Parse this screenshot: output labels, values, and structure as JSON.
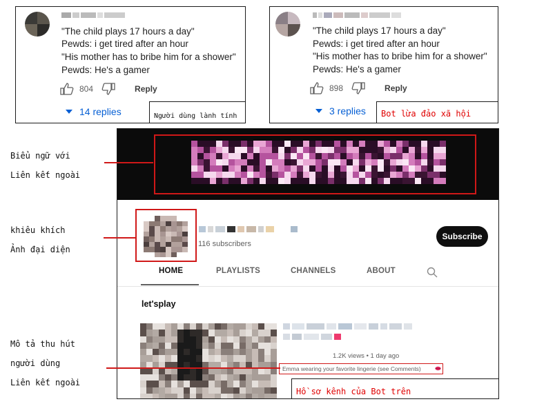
{
  "comment1": {
    "lines": [
      "\"The child plays 17 hours a day\"",
      "Pewds: i get tired after an hour",
      "\"His mother has to bribe him for a shower\"",
      "Pewds: He's a gamer"
    ],
    "likes": "804",
    "reply": "Reply",
    "replies": "14 replies",
    "tag": "Người dùng lành tính"
  },
  "comment2": {
    "lines": [
      "\"The child plays 17 hours a day\"",
      "Pewds: i get tired after an hour",
      "\"His mother has to bribe him for a shower\"",
      "Pewds: He's a gamer"
    ],
    "likes": "898",
    "reply": "Reply",
    "replies": "3 replies",
    "tag": "Bot lừa đảo xã hội"
  },
  "channel": {
    "subscribers": "116 subscribers",
    "subscribe": "Subscribe",
    "tabs": [
      "HOME",
      "PLAYLISTS",
      "CHANNELS",
      "ABOUT"
    ],
    "section_title": "let'splay",
    "video_meta": "1.2K views • 1 day ago",
    "video_description": "Emma wearing your favorite lingerie (see Comments)",
    "tag": "Hồ sơ kênh của Bot trên"
  },
  "annotations": {
    "label1": [
      "Biểu ngữ với",
      "Liên kết ngoài"
    ],
    "label2": [
      "khiêu khích",
      "Ảnh đại diện"
    ],
    "label3": [
      "Mô tả thu hút",
      "người dùng",
      "Liên kết ngoài"
    ]
  },
  "colors": {
    "annotation_red": "#d01818",
    "link_blue": "#065fd4",
    "banner_pink": "#e9a6d4"
  },
  "icons": [
    "thumbs-up-icon",
    "thumbs-down-icon",
    "caret-down-icon",
    "search-icon",
    "lips-icon"
  ]
}
